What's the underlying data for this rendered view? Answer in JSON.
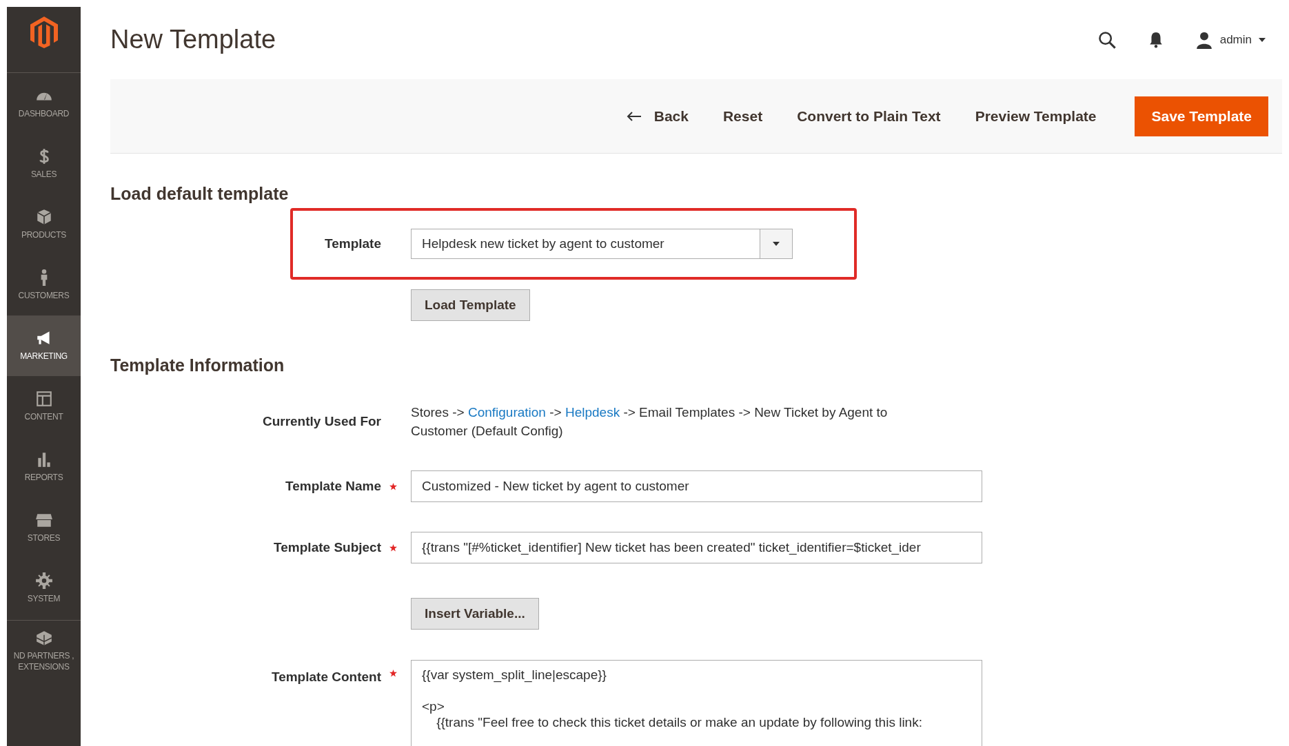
{
  "header": {
    "title": "New Template",
    "user": "admin"
  },
  "sidebar": {
    "items": [
      {
        "label": "DASHBOARD",
        "selected": false
      },
      {
        "label": "SALES",
        "selected": false
      },
      {
        "label": "PRODUCTS",
        "selected": false
      },
      {
        "label": "CUSTOMERS",
        "selected": false
      },
      {
        "label": "MARKETING",
        "selected": true
      },
      {
        "label": "CONTENT",
        "selected": false
      },
      {
        "label": "REPORTS",
        "selected": false
      },
      {
        "label": "STORES",
        "selected": false
      },
      {
        "label": "SYSTEM",
        "selected": false
      },
      {
        "label": "ND PARTNERS , EXTENSIONS",
        "selected": false
      }
    ]
  },
  "toolbar": {
    "back": "Back",
    "buttons": [
      "Reset",
      "Convert to Plain Text",
      "Preview Template"
    ],
    "primary": "Save Template"
  },
  "load_section": {
    "heading": "Load default template",
    "template_label": "Template",
    "template_value": "Helpdesk new ticket by agent to customer",
    "highlighted": true,
    "load_button": "Load Template"
  },
  "info_section": {
    "heading": "Template Information",
    "used_for_label": "Currently Used For",
    "used_for": [
      {
        "kind": "text",
        "text": "Stores -> "
      },
      {
        "kind": "link",
        "text": "Configuration"
      },
      {
        "kind": "text",
        "text": " -> "
      },
      {
        "kind": "link",
        "text": "Helpdesk"
      },
      {
        "kind": "text",
        "text": " -> Email Templates -> New Ticket by Agent to Customer  (Default Config)"
      }
    ],
    "fields": [
      {
        "kind": "input",
        "label": "Template Name",
        "required": true,
        "value": "Customized - New ticket by agent to customer"
      },
      {
        "kind": "input",
        "label": "Template Subject",
        "required": true,
        "value": "{{trans \"[#%ticket_identifier] New ticket has been created\" ticket_identifier=$ticket_ider"
      },
      {
        "kind": "button",
        "label": "Insert Variable..."
      },
      {
        "kind": "textarea",
        "label": "Template Content",
        "required": true,
        "value": "{{var system_split_line|escape}}\n\n<p>\n    {{trans \"Feel free to check this ticket details or make an update by following this link:"
      }
    ]
  }
}
